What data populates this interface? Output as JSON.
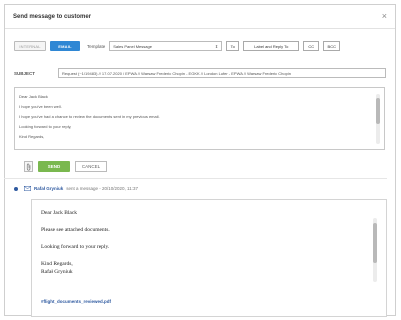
{
  "dialog": {
    "title": "Send message to customer",
    "close_glyph": "×"
  },
  "toolbar": {
    "toggle_off_label": "INTERNAL",
    "toggle_on_label": "EMAIL",
    "template_label": "Template",
    "template_value": "Sales Panel Message",
    "template_arrow": "⇕",
    "to_label": "To",
    "label_reply_label": "Label and Reply To",
    "cc_label": "CC",
    "bcc_label": "BCC"
  },
  "subject": {
    "label": "SUBJECT",
    "value": "Request (~1/19483) // 17.07.2020 / EPWA // Warsaw Frederic Chopin - EGKK // London Lufer - EPWA // Warsaw Frederic Chopin"
  },
  "editor": {
    "lines": [
      "Dear Jack Black",
      "I hope you've been well.",
      "I hope you've had a chance to review the documents sent in my previous email.",
      "Looking forward to your reply,",
      "Kind Regards,"
    ]
  },
  "actions": {
    "send_label": "SEND",
    "cancel_label": "CANCEL"
  },
  "history": {
    "author": "Rafał Gryniuk",
    "meta": "sent a message - 20/10/2020, 11:37",
    "message": {
      "greeting": "Dear Jack Black",
      "line1": "Please see attached documents.",
      "line2": "Looking forward to your reply.",
      "sign1": "Kind Regards,",
      "sign2": "Rafał Gryniuk"
    },
    "attachment": "#flight_documents_reviewed.pdf"
  },
  "colors": {
    "accent": "#2f87d4",
    "send": "#7ab84f",
    "link": "#2f5aa0"
  },
  "icons": {
    "close": "close-icon",
    "attach": "paperclip-icon",
    "message": "envelope-icon",
    "dropdown": "chevron-updown-icon"
  }
}
